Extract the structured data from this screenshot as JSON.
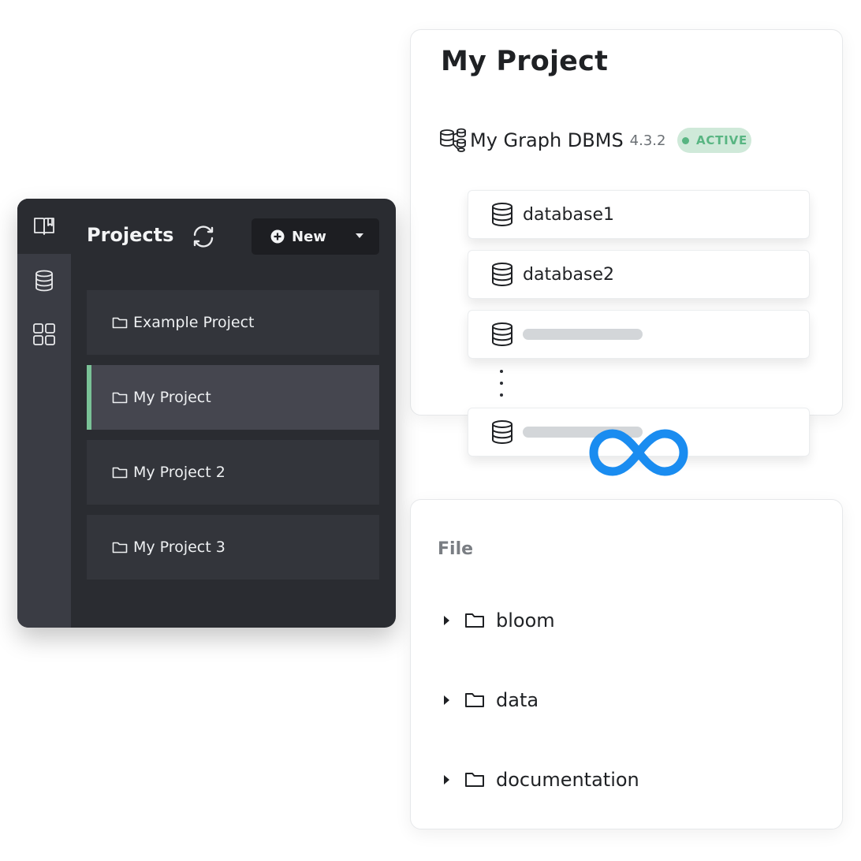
{
  "project_detail": {
    "title": "My Project",
    "dbms": {
      "icon": "graph-dbms-icon",
      "name": "My Graph DBMS",
      "version": "4.3.2",
      "status": "ACTIVE",
      "status_color": "#58b582"
    },
    "databases": [
      {
        "name": "database1",
        "icon": "database-icon"
      },
      {
        "name": "database2",
        "icon": "database-icon"
      },
      {
        "name": "",
        "icon": "database-icon"
      },
      {
        "name": "",
        "icon": "database-icon"
      }
    ],
    "infinity_icon": "infinity-icon",
    "accent_color": "#1a8cf0"
  },
  "projects_panel": {
    "title": "Projects",
    "new_label": "New",
    "rail_icons": [
      "book-icon",
      "database-icon",
      "apps-grid-icon"
    ],
    "items": [
      {
        "label": "Example Project",
        "selected": false
      },
      {
        "label": "My Project",
        "selected": true
      },
      {
        "label": "My Project 2",
        "selected": false
      },
      {
        "label": "My Project 3",
        "selected": false
      }
    ],
    "selected_accent": "#7ac297"
  },
  "file_panel": {
    "title": "File",
    "items": [
      {
        "label": "bloom"
      },
      {
        "label": "data"
      },
      {
        "label": "documentation"
      }
    ]
  }
}
